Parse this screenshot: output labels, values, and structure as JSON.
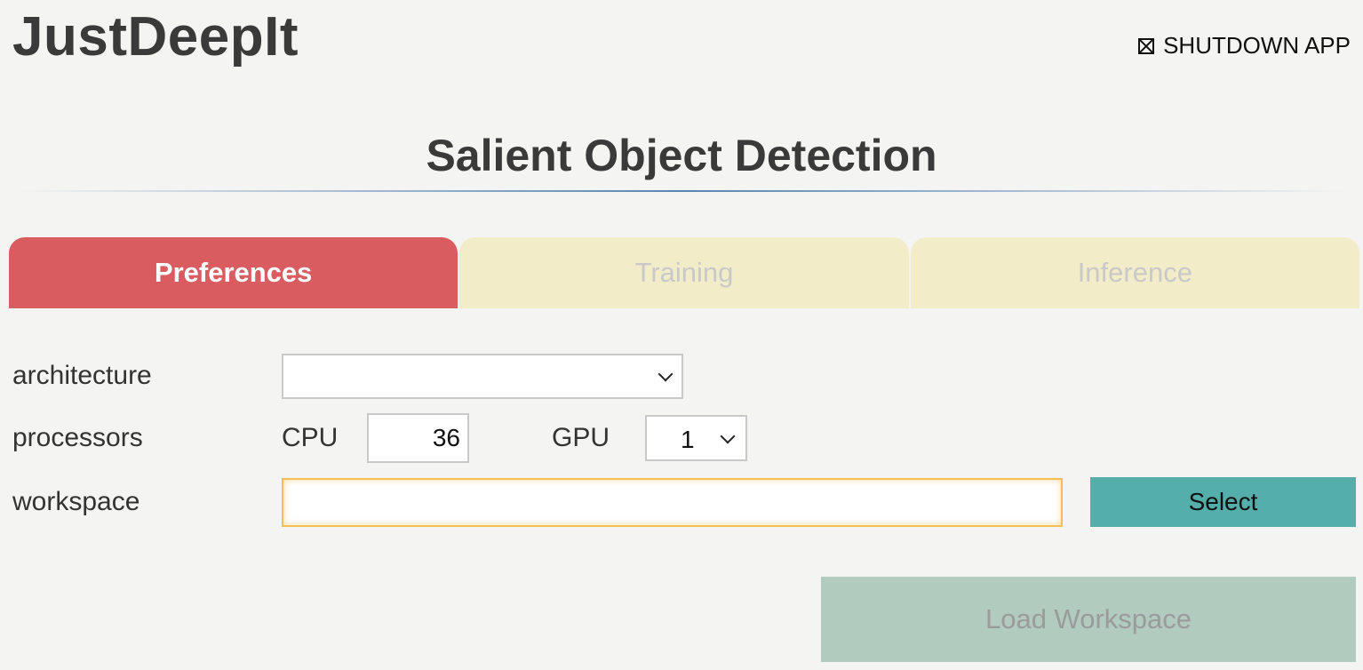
{
  "app": {
    "title": "JustDeepIt",
    "shutdown_label": "SHUTDOWN APP"
  },
  "page": {
    "title": "Salient Object Detection"
  },
  "tabs": [
    {
      "label": "Preferences",
      "active": true
    },
    {
      "label": "Training",
      "active": false
    },
    {
      "label": "Inference",
      "active": false
    }
  ],
  "preferences": {
    "architecture": {
      "label": "architecture",
      "selected": ""
    },
    "processors": {
      "label": "processors",
      "cpu_label": "CPU",
      "cpu_value": "36",
      "gpu_label": "GPU",
      "gpu_selected": "1"
    },
    "workspace": {
      "label": "workspace",
      "value": "",
      "select_label": "Select"
    },
    "load_label": "Load Workspace"
  },
  "colors": {
    "active_tab": "#d95c60",
    "inactive_tab": "#f2ecc8",
    "select_button": "#54aeaa",
    "load_button": "#b1cbbe",
    "workspace_border": "#f3bf55"
  },
  "icons": {
    "shutdown": "close-box-icon",
    "dropdown": "chevron-down-icon"
  }
}
